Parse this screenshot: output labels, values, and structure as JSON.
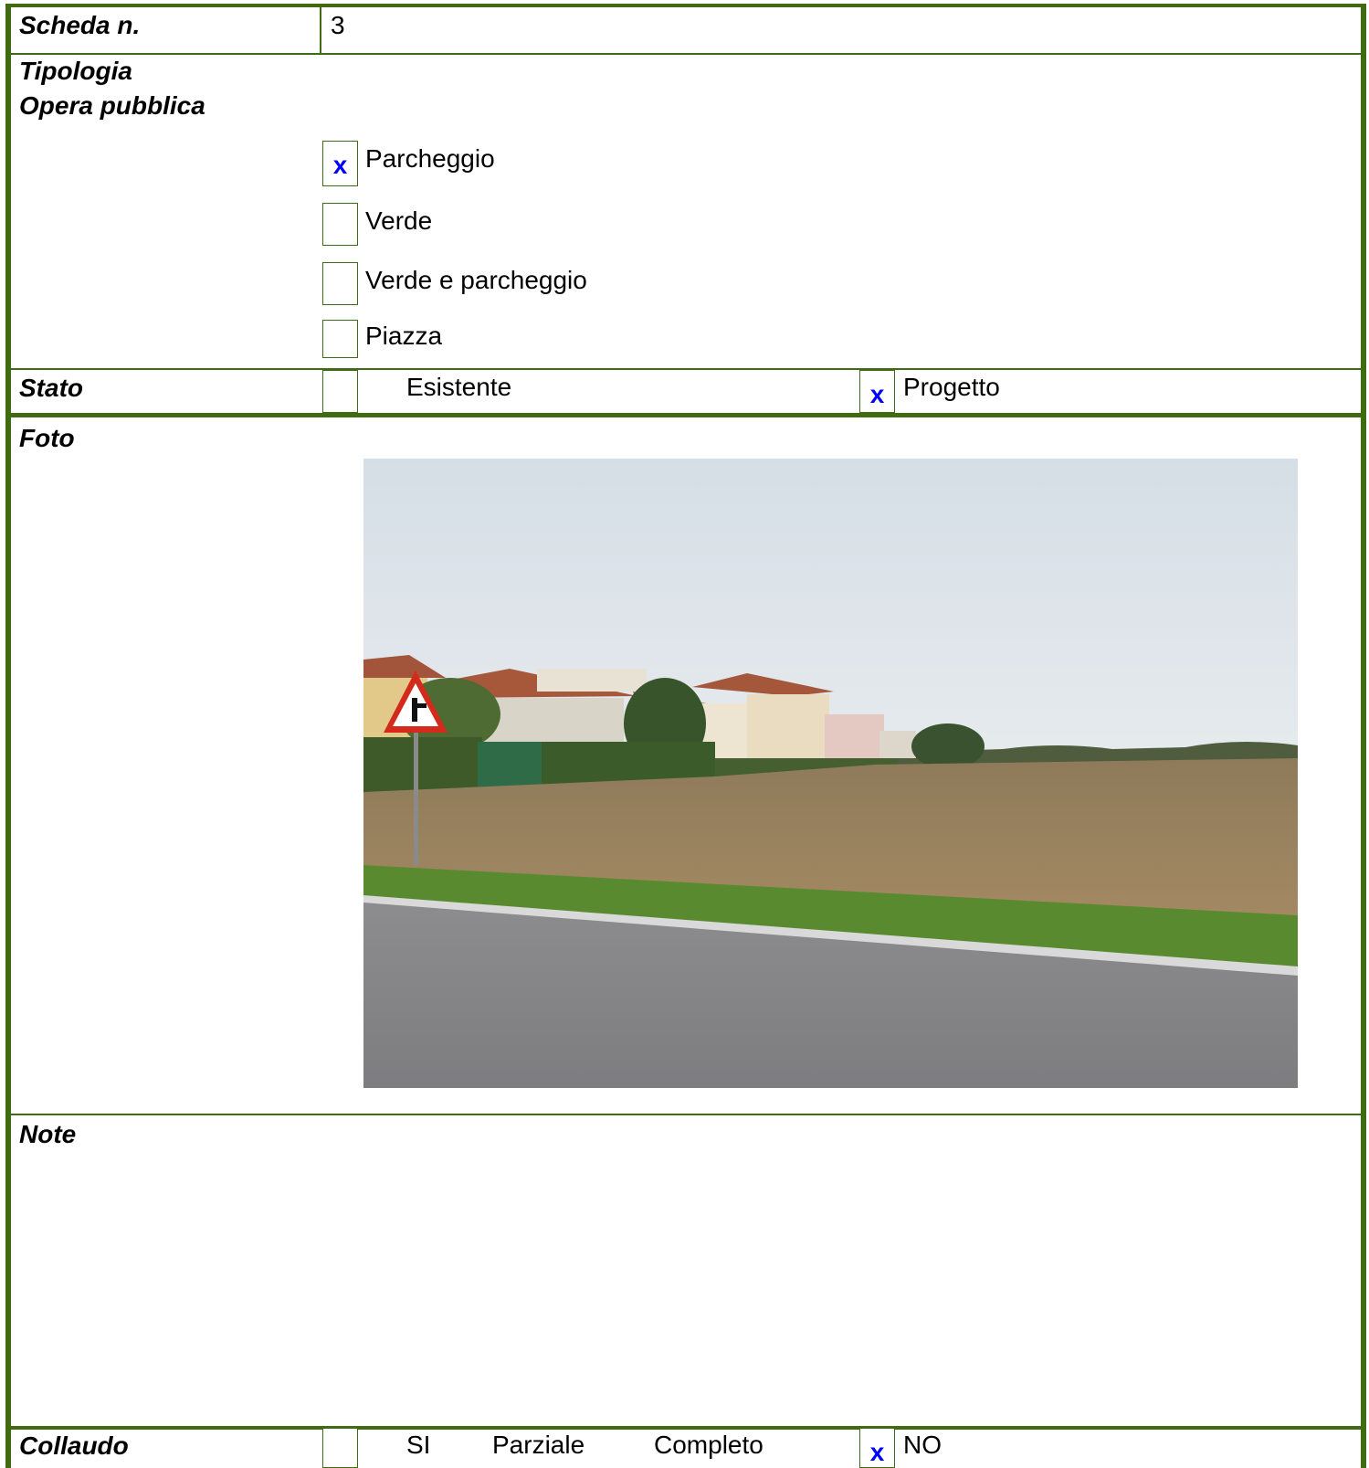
{
  "scheda": {
    "label": "Scheda n.",
    "value": "3"
  },
  "tipologia": {
    "label": "Tipologia",
    "sublabel": "Opera pubblica",
    "options": [
      {
        "label": "Parcheggio",
        "mark": "x"
      },
      {
        "label": "Verde",
        "mark": ""
      },
      {
        "label": "Verde e parcheggio",
        "mark": ""
      },
      {
        "label": "Piazza",
        "mark": ""
      }
    ]
  },
  "stato": {
    "label": "Stato",
    "existing_mark": "",
    "existing_label": "Esistente",
    "project_mark": "x",
    "project_label": "Progetto"
  },
  "foto": {
    "label": "Foto"
  },
  "note": {
    "label": "Note"
  },
  "collaudo": {
    "label": "Collaudo",
    "yes_mark": "",
    "yes_label": "SI",
    "partial_label": "Parziale",
    "complete_label": "Completo",
    "no_mark": "x",
    "no_label": "NO"
  },
  "colors": {
    "border": "#3f6b12",
    "mark": "#0000ff"
  }
}
